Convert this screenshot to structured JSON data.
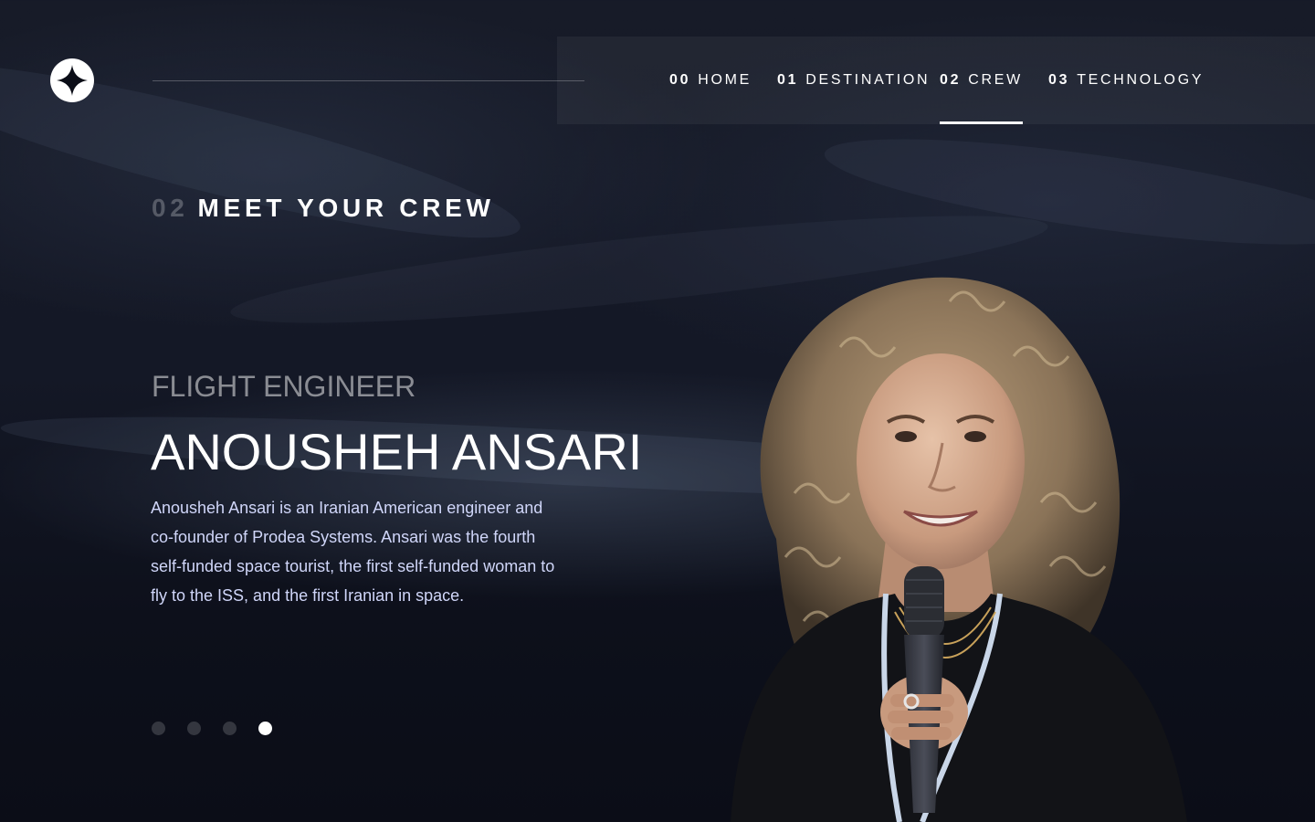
{
  "header": {
    "nav": [
      {
        "num": "00",
        "label": "HOME",
        "active": false
      },
      {
        "num": "01",
        "label": "DESTINATION",
        "active": false
      },
      {
        "num": "02",
        "label": "CREW",
        "active": true
      },
      {
        "num": "03",
        "label": "TECHNOLOGY",
        "active": false
      }
    ]
  },
  "page": {
    "section_num": "02",
    "section_title": "MEET YOUR CREW"
  },
  "crew": {
    "role": "FLIGHT ENGINEER",
    "name": "ANOUSHEH ANSARI",
    "bio": "Anousheh Ansari is an Iranian American engineer and co-founder of Prodea Systems. Ansari was the fourth self-funded space tourist, the first self-funded woman to fly to the ISS, and the first Iranian in space."
  },
  "carousel": {
    "count": 4,
    "active_index": 3
  },
  "colors": {
    "background": "#0b0d17",
    "text_light": "#d0d6f9",
    "white": "#ffffff"
  }
}
